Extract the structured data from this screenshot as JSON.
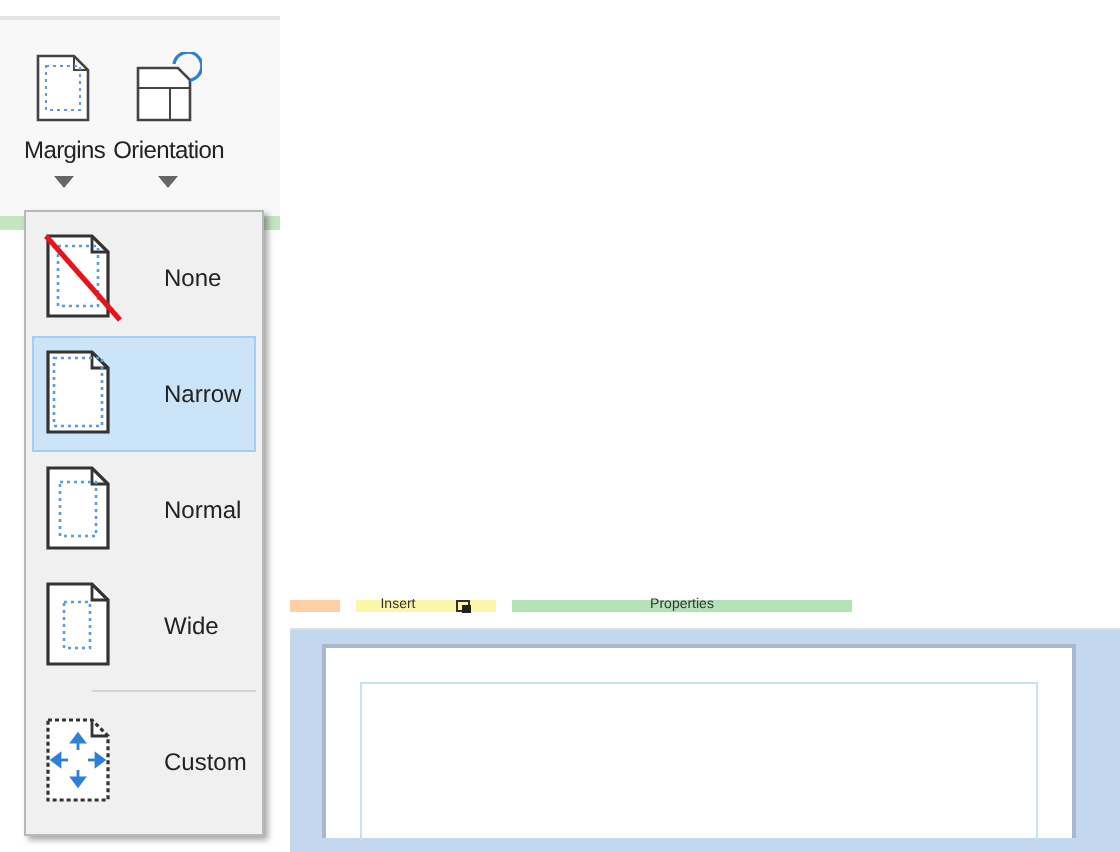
{
  "ribbon": {
    "buttons": [
      {
        "label": "Margins",
        "kind": "margins"
      },
      {
        "label": "Orientation",
        "kind": "orientation"
      }
    ]
  },
  "margins_menu": {
    "items": [
      {
        "label": "None",
        "kind": "none",
        "selected": false,
        "separator_before": false
      },
      {
        "label": "Narrow",
        "kind": "narrow",
        "selected": true,
        "separator_before": false
      },
      {
        "label": "Normal",
        "kind": "normal",
        "selected": false,
        "separator_before": false
      },
      {
        "label": "Wide",
        "kind": "wide",
        "selected": false,
        "separator_before": false
      },
      {
        "label": "Custom",
        "kind": "custom",
        "selected": false,
        "separator_before": true
      }
    ]
  },
  "group_strips": [
    {
      "color": "#fbd0a6"
    },
    {
      "label": "Insert",
      "color": "#fcf6a8",
      "launcher": true
    },
    {
      "label": "Properties",
      "color": "#b5e1b7"
    }
  ]
}
